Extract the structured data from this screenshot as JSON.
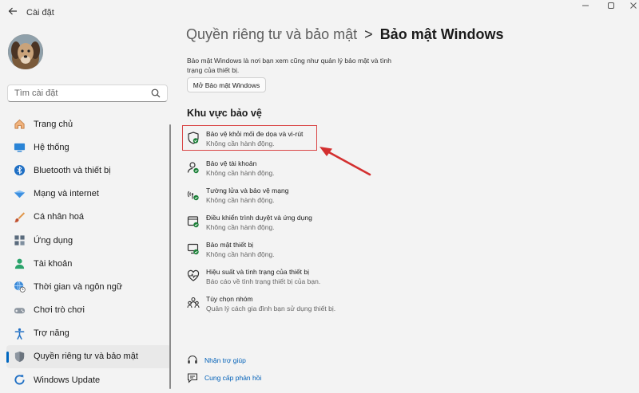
{
  "window": {
    "app_title": "Cài đặt",
    "controls": [
      "minimize-icon",
      "maximize-icon",
      "close-icon"
    ]
  },
  "search": {
    "placeholder": "Tìm cài đặt",
    "icon": "search-icon"
  },
  "sidebar": {
    "items": [
      {
        "label": "Trang chủ",
        "icon": "home-icon"
      },
      {
        "label": "Hệ thống",
        "icon": "monitor-icon"
      },
      {
        "label": "Bluetooth và thiết bị",
        "icon": "bluetooth-icon"
      },
      {
        "label": "Mạng và internet",
        "icon": "wifi-diamond-icon"
      },
      {
        "label": "Cá nhân hoá",
        "icon": "brush-icon"
      },
      {
        "label": "Ứng dụng",
        "icon": "apps-icon"
      },
      {
        "label": "Tài khoản",
        "icon": "person-icon"
      },
      {
        "label": "Thời gian và ngôn ngữ",
        "icon": "globe-clock-icon"
      },
      {
        "label": "Chơi trò chơi",
        "icon": "gamepad-icon"
      },
      {
        "label": "Trợ năng",
        "icon": "accessibility-icon"
      },
      {
        "label": "Quyền riêng tư và bảo mật",
        "icon": "shield-icon",
        "active": true
      },
      {
        "label": "Windows Update",
        "icon": "update-icon"
      }
    ]
  },
  "breadcrumb": {
    "parent": "Quyền riêng tư và bảo mật",
    "separator": ">",
    "current": "Bảo mật Windows"
  },
  "main": {
    "description": "Bảo mật Windows là nơi bạn xem cũng như quản lý bảo mật và tình trạng của thiết bị.",
    "open_button": "Mở Bảo mật Windows",
    "section_title": "Khu vực bảo vệ",
    "areas": [
      {
        "title": "Bảo vệ khỏi mối đe dọa và vi-rút",
        "subtitle": "Không cần hành động.",
        "icon": "virus-shield-icon",
        "highlighted": true
      },
      {
        "title": "Bảo vệ tài khoản",
        "subtitle": "Không cần hành động.",
        "icon": "account-protection-icon"
      },
      {
        "title": "Tường lửa và bảo vệ mạng",
        "subtitle": "Không cần hành động.",
        "icon": "firewall-icon"
      },
      {
        "title": "Điều khiển trình duyệt và ứng dụng",
        "subtitle": "Không cần hành động.",
        "icon": "app-browser-icon"
      },
      {
        "title": "Bảo mật thiết bị",
        "subtitle": "Không cần hành động.",
        "icon": "device-security-icon"
      },
      {
        "title": "Hiệu suất và tình trạng của thiết bị",
        "subtitle": "Báo cáo về tình trạng thiết bị của bạn.",
        "icon": "heart-pulse-icon"
      },
      {
        "title": "Tùy chọn nhóm",
        "subtitle": "Quản lý cách gia đình bạn sử dụng thiết bị.",
        "icon": "family-icon"
      }
    ],
    "footer_links": [
      {
        "label": "Nhận trợ giúp",
        "icon": "help-icon"
      },
      {
        "label": "Cung cấp phản hồi",
        "icon": "feedback-icon"
      }
    ]
  },
  "colors": {
    "accent": "#0067c0",
    "highlight_border": "#d94646",
    "annotation_arrow": "#d32f2f",
    "link": "#0060b8",
    "shield_green": "#1a7f37"
  }
}
